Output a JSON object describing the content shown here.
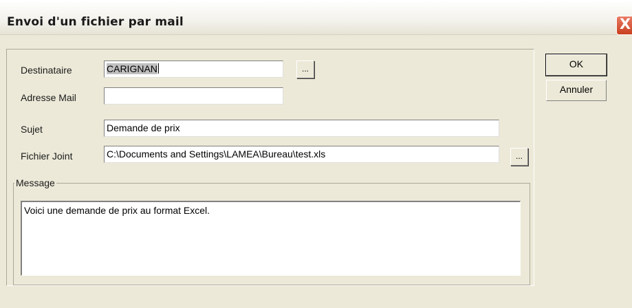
{
  "window": {
    "title": "Envoi d'un fichier par mail",
    "close_glyph": "X"
  },
  "form": {
    "destinataire_label": "Destinataire",
    "destinataire_value": "CARIGNAN",
    "adresse_label": "Adresse Mail",
    "adresse_value": "",
    "sujet_label": "Sujet",
    "sujet_value": "Demande de prix",
    "fichier_label": "Fichier Joint",
    "fichier_value": "C:\\Documents and Settings\\LAMEA\\Bureau\\test.xls",
    "browse_label": "..."
  },
  "message": {
    "group_label": "Message",
    "text": "Voici une demande de prix au format Excel."
  },
  "buttons": {
    "ok_label": "OK",
    "cancel_label": "Annuler"
  }
}
